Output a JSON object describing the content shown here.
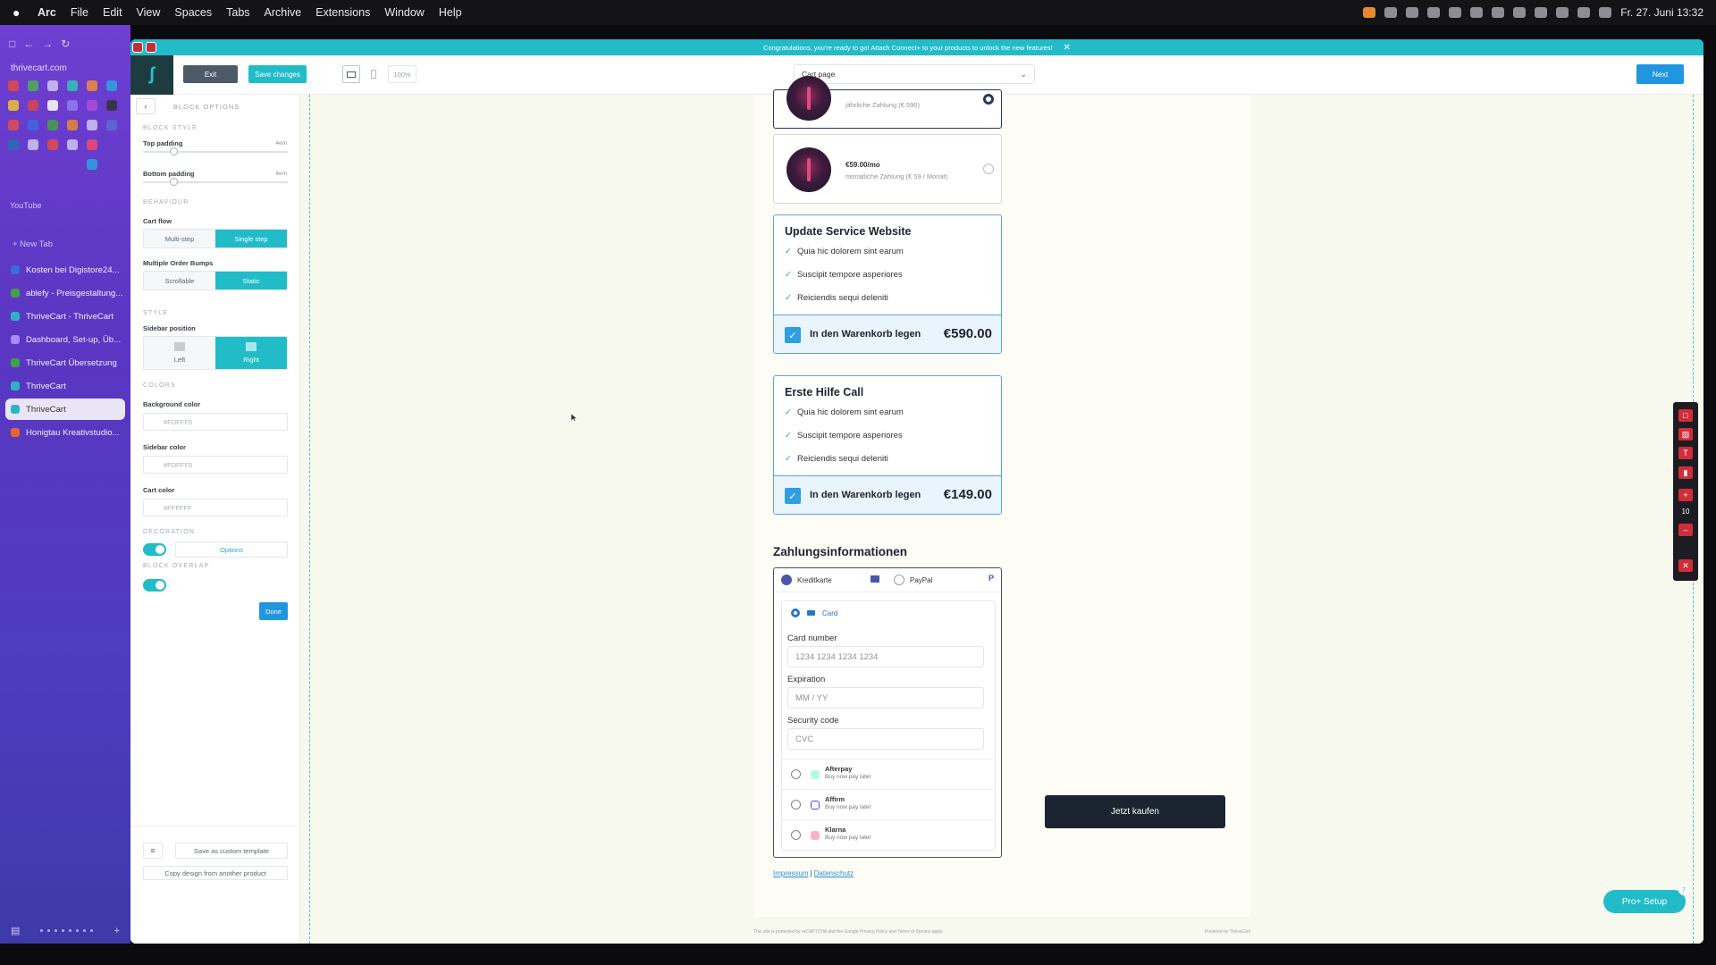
{
  "menubar": {
    "apple": "",
    "items": [
      "Arc",
      "File",
      "Edit",
      "View",
      "Spaces",
      "Tabs",
      "Archive",
      "Extensions",
      "Window",
      "Help"
    ],
    "clock": "Fr. 27. Juni 13:32"
  },
  "arc": {
    "url": "thrivecart.com",
    "youtube_label": "YouTube",
    "new_tab": "+ New Tab",
    "tabs": [
      {
        "label": "Kosten bei Digistore24..."
      },
      {
        "label": "ablefy - Preisgestaltung..."
      },
      {
        "label": "ThriveCart - ThriveCart"
      },
      {
        "label": "Dashboard, Set-up, Üb..."
      },
      {
        "label": "ThriveCart Übersetzung"
      },
      {
        "label": "ThriveCart"
      },
      {
        "label": "ThriveCart"
      },
      {
        "label": "Honigtau Kreativstudio..."
      }
    ]
  },
  "banner": {
    "text": "Congratulations, you're ready to go! Attach Connect+ to your products to unlock the new features!",
    "close": "✕"
  },
  "toolbar": {
    "exit": "Exit",
    "save": "Save changes",
    "zoom": "100%",
    "page_select": "Cart page",
    "next": "Next"
  },
  "panel": {
    "back": "‹",
    "title": "BLOCK OPTIONS",
    "block_style": "BLOCK STYLE",
    "top_padding": "Top padding",
    "top_padding_val": "4em",
    "bottom_padding": "Bottom padding",
    "bottom_padding_val": "4em",
    "behaviour": "BEHAVIOUR",
    "cart_flow": "Cart flow",
    "cart_flow_opts": [
      "Multi-step",
      "Single step"
    ],
    "order_bumps": "Multiple Order Bumps",
    "order_bumps_opts": [
      "Scrollable",
      "Static"
    ],
    "style": "STYLE",
    "sidebar_position": "Sidebar position",
    "sidebar_opts": [
      "Left",
      "Right"
    ],
    "colors": "COLORS",
    "bg_color": "Background color",
    "bg_color_val": "#FDFFF5",
    "sidebar_color": "Sidebar color",
    "sidebar_color_val": "#FDFFF5",
    "cart_color": "Cart color",
    "cart_color_val": "#FFFFFF",
    "decoration": "DECORATION",
    "options": "Options",
    "block_overlap": "BLOCK OVERLAP",
    "done": "Done",
    "save_template": "Save as custom template",
    "copy_design": "Copy design from another product"
  },
  "cart": {
    "plan1_sub": "jährliche Zahlung (€ 590)",
    "plan2_price": "€59.00/mo",
    "plan2_sub": "monatliche Zahlung (€ 59 / Monat)",
    "bump1": {
      "title": "Update Service Website",
      "items": [
        "Quia hic dolorem sint earum",
        "Suscipit tempore asperiores",
        "Reiciendis sequi deleniti"
      ],
      "cta": "In den Warenkorb legen",
      "price": "€590.00"
    },
    "bump2": {
      "title": "Erste Hilfe Call",
      "items": [
        "Quia hic dolorem sint earum",
        "Suscipit tempore asperiores",
        "Reiciendis sequi deleniti"
      ],
      "cta": "In den Warenkorb legen",
      "price": "€149.00"
    },
    "payment_heading": "Zahlungsinformationen",
    "pay_tabs": [
      "Kreditkarte",
      "PayPal"
    ],
    "card_tab": "Card",
    "card_number_label": "Card number",
    "card_number_ph": "1234 1234 1234 1234",
    "expiration_label": "Expiration",
    "expiration_ph": "MM / YY",
    "security_label": "Security code",
    "security_ph": "CVC",
    "bnpl": [
      {
        "name": "Afterpay",
        "sub": "Buy now pay later"
      },
      {
        "name": "Affirm",
        "sub": "Buy now pay later"
      },
      {
        "name": "Klarna",
        "sub": "Buy now pay later"
      }
    ],
    "impressum": "Impressum",
    "sep": "|",
    "datenschutz": "Datenschutz",
    "buy": "Jetzt kaufen",
    "fineprint": "This site is protected by reCAPTCHA and the Google Privacy Policy and Terms of Service apply.",
    "powered": "Powered by ThriveCart"
  },
  "tools": {
    "count": "10"
  },
  "pro_setup": {
    "label": "Pro+ Setup",
    "badge": "7"
  },
  "colors": {
    "accent": "#21bcc8",
    "primary_blue": "#2196e0",
    "canvas": "#f7f9ee"
  }
}
